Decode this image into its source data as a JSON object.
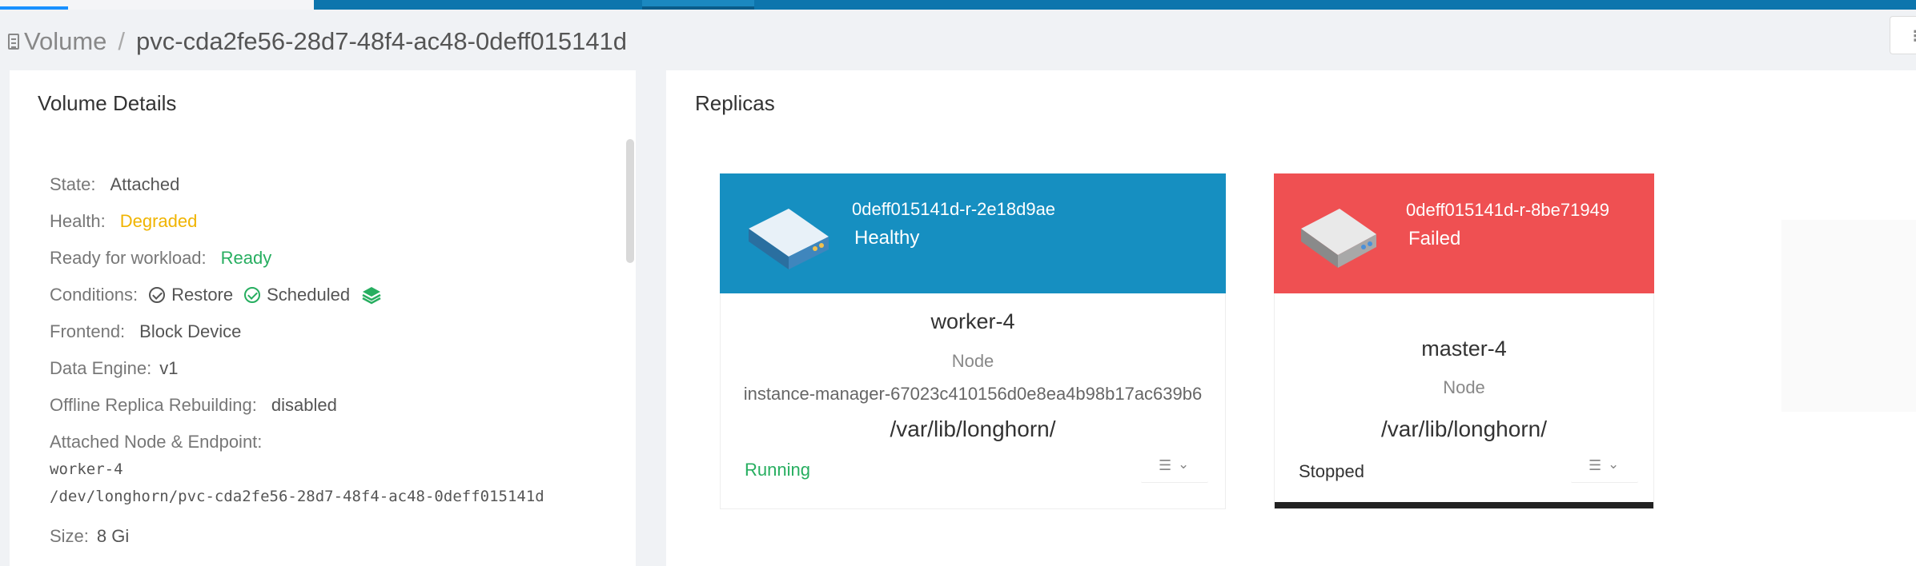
{
  "breadcrumb": {
    "parent": "Volume",
    "separator": "/",
    "current": "pvc-cda2fe56-28d7-48f4-ac48-0deff015141d"
  },
  "details": {
    "title": "Volume Details",
    "state_label": "State:",
    "state_value": "Attached",
    "health_label": "Health:",
    "health_value": "Degraded",
    "ready_label": "Ready for workload:",
    "ready_value": "Ready",
    "conditions_label": "Conditions:",
    "conditions": [
      "Restore",
      "Scheduled"
    ],
    "frontend_label": "Frontend:",
    "frontend_value": "Block Device",
    "engine_label": "Data Engine:",
    "engine_value": "v1",
    "rebuild_label": "Offline Replica Rebuilding:",
    "rebuild_value": "disabled",
    "attached_label": "Attached Node & Endpoint:",
    "attached_node": "worker-4",
    "attached_endpoint": "/dev/longhorn/pvc-cda2fe56-28d7-48f4-ac48-0deff015141d",
    "size_label": "Size:",
    "size_value": "8 Gi"
  },
  "replicas": {
    "title": "Replicas",
    "cards": [
      {
        "id": "0deff015141d-r-2e18d9ae",
        "state": "Healthy",
        "node": "worker-4",
        "node_label": "Node",
        "instance_manager": "instance-manager-67023c410156d0e8ea4b98b17ac639b6",
        "path": "/var/lib/longhorn/",
        "status": "Running",
        "color": "#168fc1"
      },
      {
        "id": "0deff015141d-r-8be71949",
        "state": "Failed",
        "node": "master-4",
        "node_label": "Node",
        "path": "/var/lib/longhorn/",
        "status": "Stopped",
        "color": "#ef5052"
      }
    ]
  },
  "colors": {
    "accent_blue": "#0d75ad",
    "degraded": "#f0b400",
    "ready": "#27ae60"
  },
  "icons": [
    "doc-icon",
    "check-circle-icon",
    "layers-icon",
    "disk-icon",
    "list-icon",
    "chevron-down-icon"
  ]
}
